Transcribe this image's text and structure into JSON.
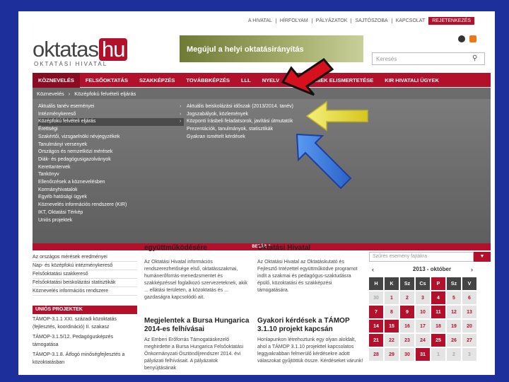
{
  "top_nav": [
    "A HIVATAL",
    "HÍRFOLYAM",
    "PÁLYÁZATOK",
    "SAJTÓSZOBA",
    "KAPCSOLAT",
    "REJETENKEZÉS"
  ],
  "logo": {
    "main": "oktatas",
    "tld": "hu",
    "sub": "OKTATÁSI HIVATAL"
  },
  "banner_text": "Megújul a helyi oktatásirányítás",
  "search_placeholder": "Keresés",
  "main_menu": [
    "KÖZNEVELÉS",
    "FELSŐOKTATÁS",
    "SZAKKÉPZÉS",
    "TOVÁBBKÉPZÉS",
    "LLL",
    "NYELV",
    "KÉPESÍTÉSEK ELISMERTETÉSE",
    "KIR HIVATALI ÜGYEK"
  ],
  "breadcrumb": [
    "Köznevelés",
    "Középfokú felvételi eljárás"
  ],
  "dropdown_left": [
    "Aktuális tanév eseményei",
    "Intézménykereső",
    "Középfokú felvételi eljárás",
    "Érettségi",
    "Szakértői, vizsgaelnöki névjegyzékek",
    "Tanulmányi versenyek",
    "Országos és nemzetközi mérések",
    "Diák- és pedagógusigazolványok",
    "Kerettantervek",
    "Tankönyv",
    "Ellenőrzések a köznevelésben",
    "Kormányhivatalok",
    "Egyéb hatósági ügyek",
    "Köznevelés információs rendszere (KIR)",
    "IKT, Oktatási Térkép",
    "Uniós projektek"
  ],
  "dropdown_right": [
    "Aktuális beiskolázási időszak (2013/2014. tanév)",
    "Jogszabályok, közlemények",
    "Központi írásbeli feladatsorok, javítási útmutatók",
    "Prezentációk, tanulmányok, statisztikák",
    "Gyakran ismételt kérdések"
  ],
  "close_label": "BEZÁR ⌃",
  "left_list": [
    "Az országos mérések eredményei",
    "Nap- és középfokú intézménykereső",
    "Felsőoktatási szakkereső",
    "Felsőoktatási beiskolázási statisztikák",
    "Köznevelés információs rendszere"
  ],
  "unios_head": "UNIÓS PROJEKTEK",
  "unios_items": [
    "TÁMOP-3.1.1 XXI. századi közoktatás (fejlesztés, koordináció) II. szakasz",
    "TÁMOP-3.1.5/12. Pedagógusképzés támogatása",
    "TÁMOP-3.1.8. Átfogó minőségfejlesztés a közoktatásban"
  ],
  "news": [
    {
      "head_top": "együttműködésére",
      "title": "Megjelentek a Bursa Hungarica 2014-es felhívásai",
      "body": "Az Emberi Erőforrás Támogatáskezelő meghirdette a Bursa Hungarica Felsőoktatási Önkormányzati Ösztöndíjrendszer 2014. évi pályázati felhívásait. A pályázatok benyújtásának"
    },
    {
      "head_top": "Oktatási Hivatal",
      "title": "Gyakori kérdések a TÁMOP 3.1.10 projekt kapcsán",
      "body": "Honlapunkon létrehoztunk egy olyan aloldalt, ahol a TÁMOP 3.1.10 projekttel kapcsolatos leggyakrabban felmerülő kérdésekre adott válaszokat gyűjtöttük össze. Kérdéseket várunk!"
    }
  ],
  "news_intro": [
    "Az Oktatási Hivatal információs rendszerezhetősége első, oktatásszakmai, humánerőforrás-menedzsmentet és szakképzéssel foglalkozó szervezeteknek, akik ... ellátási területen, a közoktatás és ... gazdaságra kapcsolódó ait.",
    "Az Oktatási Hivatal az Oktatáskutató és Fejlesztő Intézettel együttműködve programot indít a szakmai és pedagógus-szaktudásra épülő, közoktatási és szakképzési támogatására."
  ],
  "calendar": {
    "filter": "Szűrés esemény fajtákra",
    "month": "2013 - október",
    "days": [
      "H",
      "K",
      "Sz",
      "Cs",
      "P",
      "Sz",
      "V"
    ],
    "dates": [
      "30",
      "1",
      "2",
      "3",
      "4",
      "5",
      "6",
      "7",
      "8",
      "9",
      "10",
      "11",
      "12",
      "13",
      "14",
      "15",
      "16",
      "17",
      "18",
      "19",
      "20",
      "21",
      "22",
      "23",
      "24",
      "25",
      "26",
      "27",
      "28",
      "29",
      "30",
      "31",
      "1",
      "2",
      "3"
    ],
    "event_dates": [
      "4",
      "7",
      "9",
      "11",
      "14",
      "15",
      "21",
      "25",
      "31"
    ]
  }
}
